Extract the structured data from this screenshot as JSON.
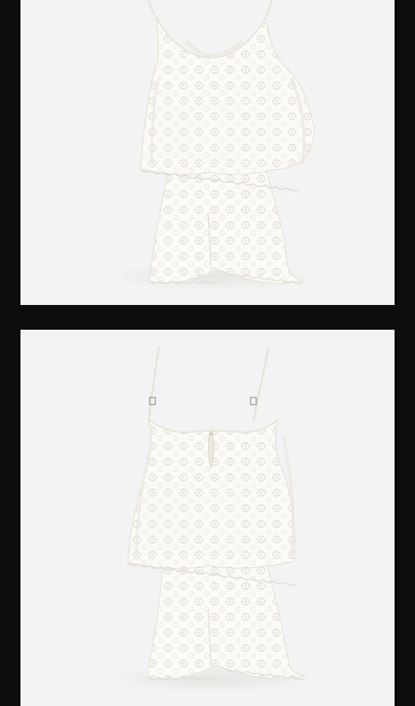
{
  "gallery": {
    "items": [
      {
        "view": "front",
        "icon": "lace-romper-front-photo"
      },
      {
        "view": "back",
        "icon": "lace-romper-back-photo"
      }
    ]
  },
  "colors": {
    "page_background": "#0d0d0d",
    "photo_background": "#f3f3f3",
    "garment": "#fbfaf6",
    "lace_pattern": "#e7e4dc"
  }
}
